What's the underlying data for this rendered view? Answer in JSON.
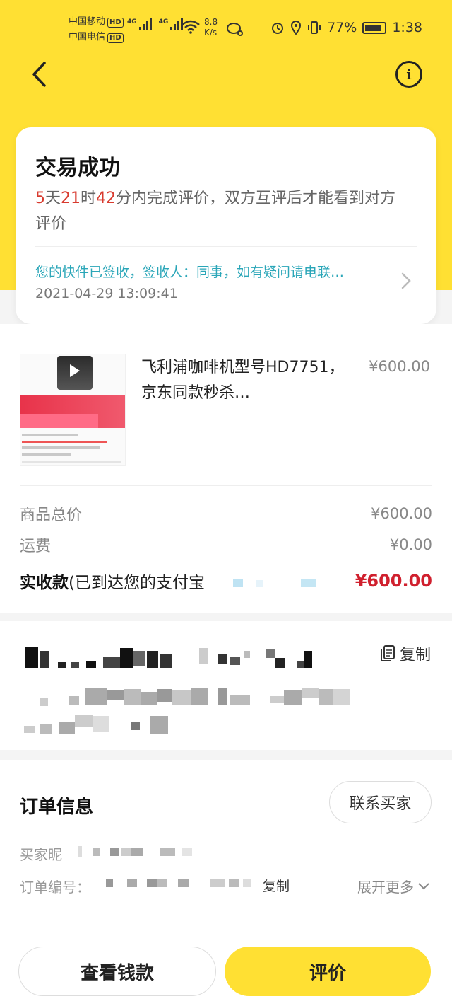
{
  "status_bar": {
    "carrier1": "中国移动",
    "carrier2": "中国电信",
    "hd_badge": "HD",
    "net1": "4G",
    "net2": "4G",
    "speed_value": "8.8",
    "speed_unit": "K/s",
    "battery": "77%",
    "time": "1:38"
  },
  "header": {
    "back_icon": "chevron-left-icon",
    "info_icon": "info-icon",
    "info_glyph": "i"
  },
  "status_card": {
    "title": "交易成功",
    "countdown": {
      "days": "5",
      "days_unit": "天",
      "hours": "21",
      "hours_unit": "时",
      "minutes": "42",
      "minutes_suffix": "分内完成评价，双方互评后才能看到对方评价"
    },
    "express_text": "您的快件已签收，签收人：同事，如有疑问请电联…",
    "express_time": "2021-04-29 13:09:41"
  },
  "product": {
    "name": "飞利浦咖啡机型号HD7751，京东同款秒杀…",
    "price": "¥600.00"
  },
  "summary": {
    "goods_total_label": "商品总价",
    "goods_total_value": "¥600.00",
    "shipping_label": "运费",
    "shipping_value": "¥0.00",
    "received_label": "实收款",
    "received_note": "(已到达您的支付宝",
    "received_value": "¥600.00"
  },
  "address": {
    "copy_label": "复制",
    "copy_icon": "copy-icon"
  },
  "order_info": {
    "title": "订单信息",
    "contact_button": "联系买家",
    "buyer_label": "买家昵",
    "order_no_label": "订单编号：",
    "copy_label": "复制",
    "expand_label": "展开更多"
  },
  "actions": {
    "view_money": "查看钱款",
    "review": "评价"
  },
  "colors": {
    "brand_yellow": "#ffe033",
    "price_red": "#d0202e",
    "link_teal": "#2aa6b8"
  }
}
